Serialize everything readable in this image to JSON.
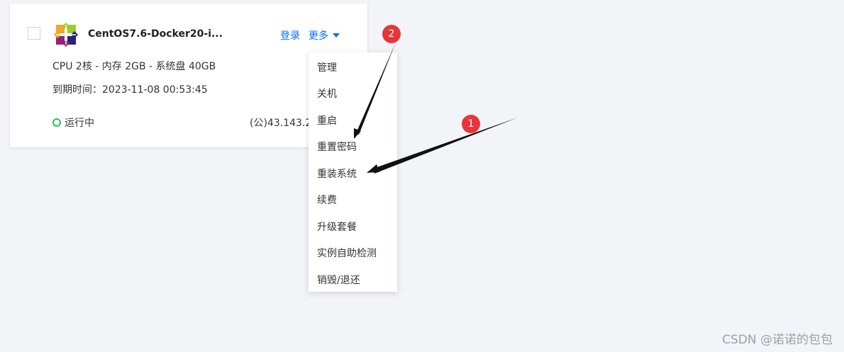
{
  "instance": {
    "name": "CentOS7.6-Docker20-i...",
    "login_label": "登录",
    "more_label": "更多",
    "spec": "CPU 2核 - 内存 2GB - 系统盘 40GB",
    "expire": "到期时间：2023-11-08 00:53:45",
    "status": "运行中",
    "ip": "(公)43.143.2"
  },
  "menu": {
    "items": [
      {
        "label": "管理"
      },
      {
        "label": "关机"
      },
      {
        "label": "重启"
      },
      {
        "label": "重置密码"
      },
      {
        "label": "重装系统"
      },
      {
        "label": "续费"
      },
      {
        "label": "升级套餐"
      },
      {
        "label": "实例自助检测"
      },
      {
        "label": "销毁/退还"
      }
    ]
  },
  "annotations": {
    "one": "1",
    "two": "2"
  },
  "watermark": "CSDN @诺诺的包包",
  "colors": {
    "link": "#006eff",
    "status_running": "#2fbf5b",
    "annotation": "#e8353a",
    "page_bg": "#f3f4f7"
  },
  "icons": {
    "logo": "centos-logo-icon",
    "dropdown": "caret-down-icon",
    "status": "status-ring-icon"
  }
}
